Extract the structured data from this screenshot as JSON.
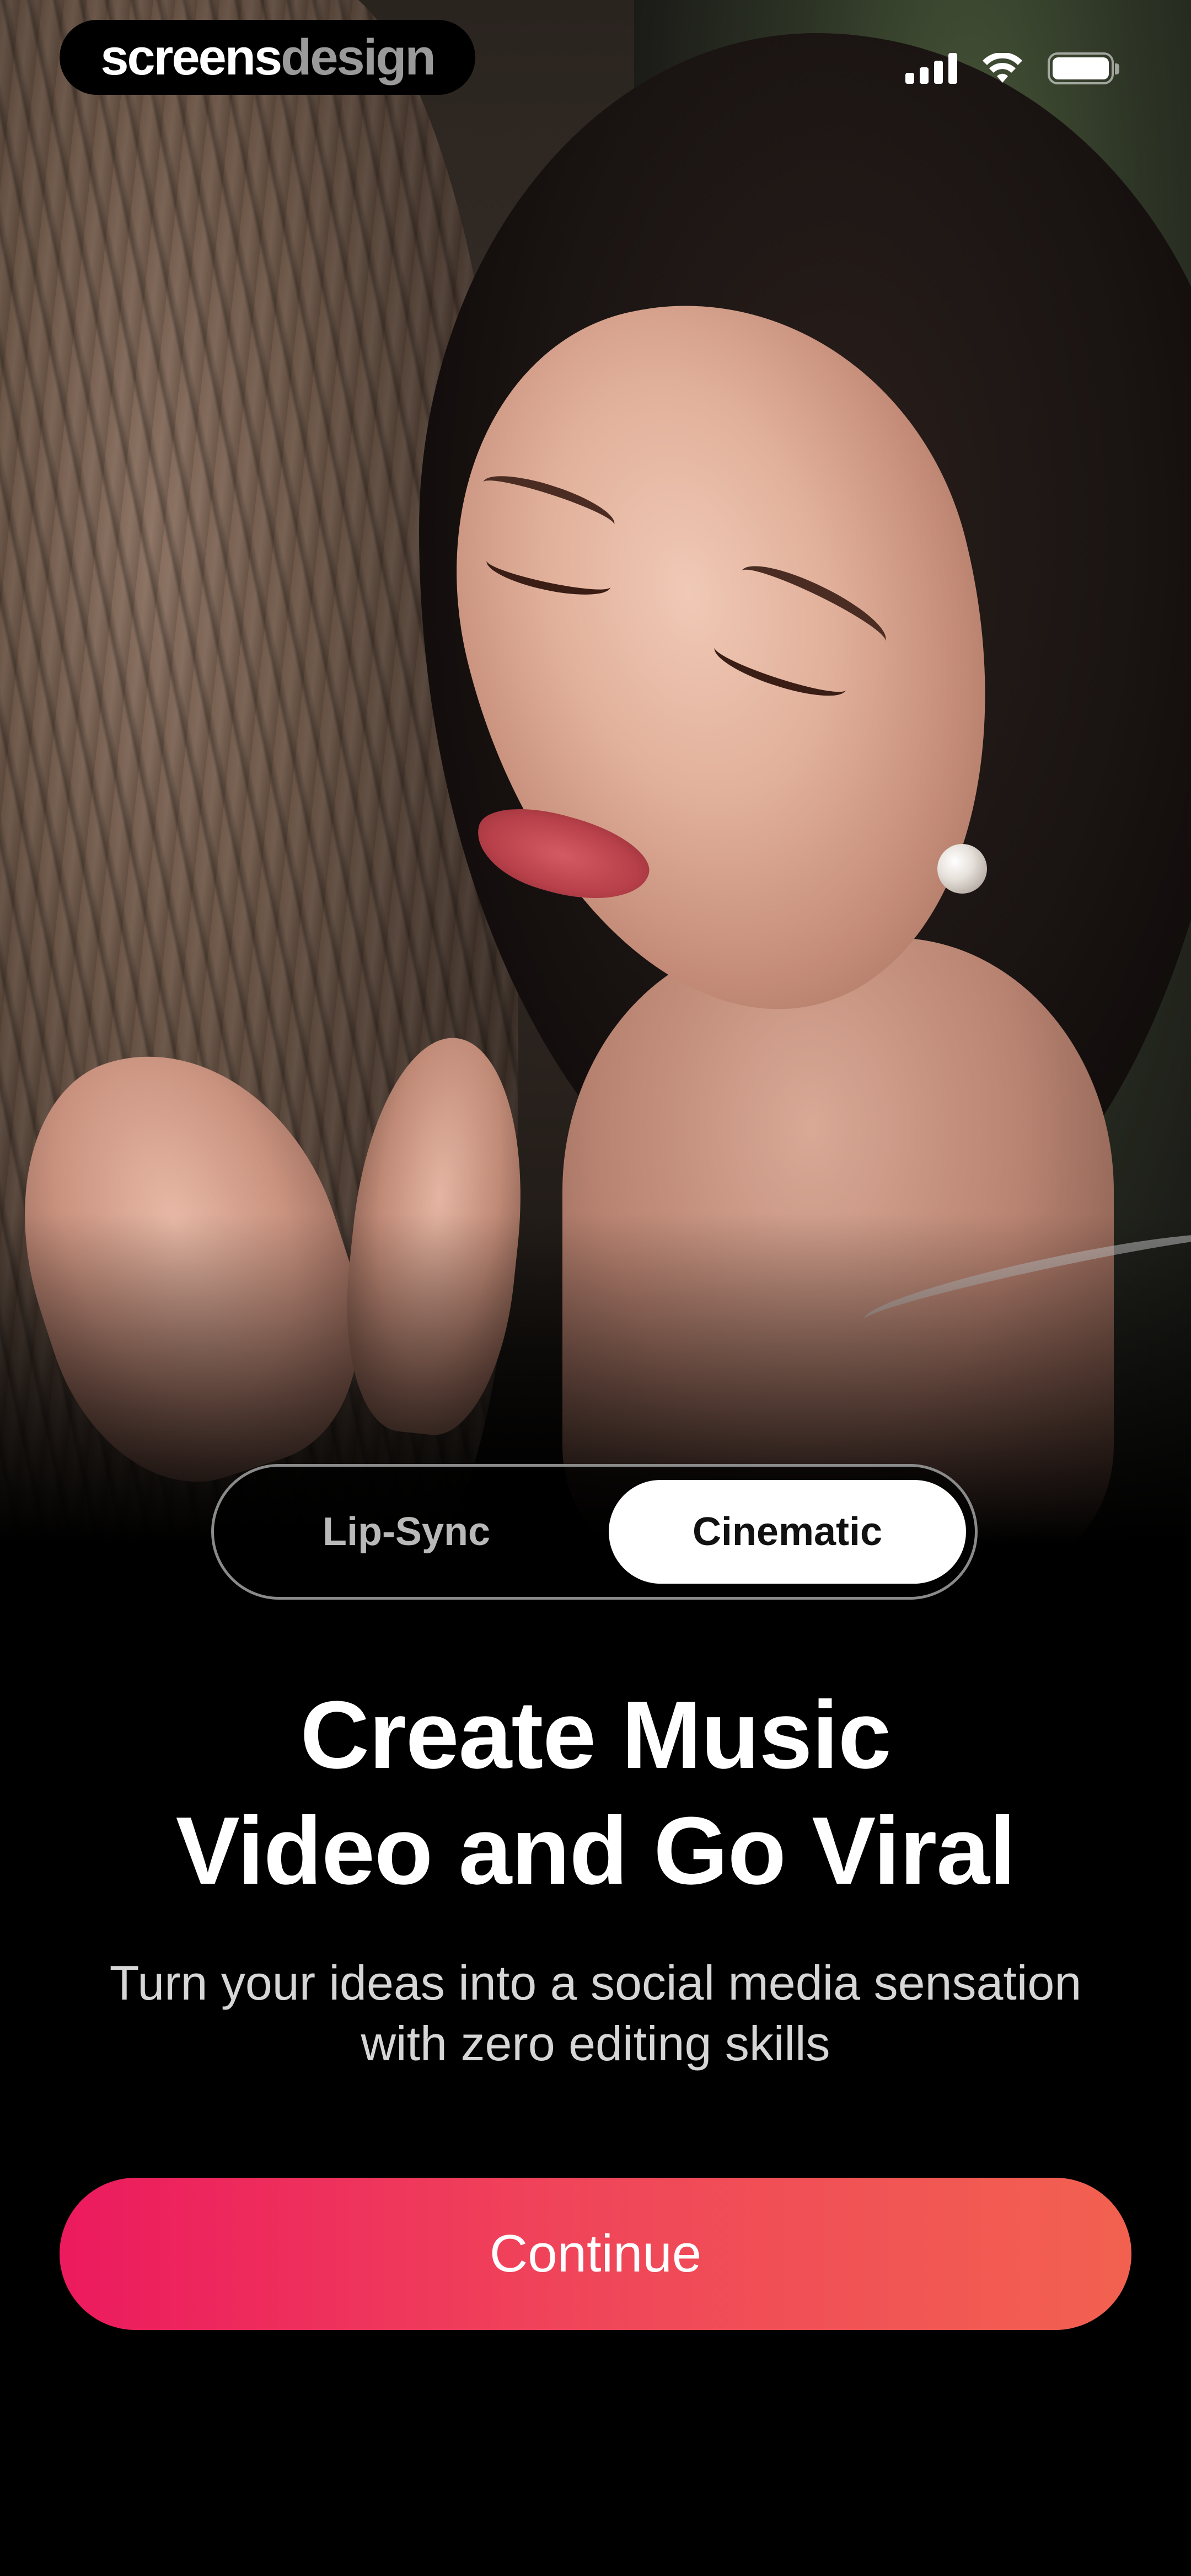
{
  "watermark": {
    "part1": "screens",
    "part2": "design"
  },
  "status_bar": {
    "signal_icon": "cellular-signal-icon",
    "wifi_icon": "wifi-icon",
    "battery_icon": "battery-icon",
    "battery_level": 1.0
  },
  "hero": {
    "image": "woman-leaning-on-tree-photo"
  },
  "mode_toggle": {
    "options": [
      "Lip-Sync",
      "Cinematic"
    ],
    "selected": "Cinematic"
  },
  "headline": {
    "line1": "Create Music",
    "line2": "Video and Go Viral"
  },
  "subtitle": {
    "line1": "Turn your ideas into a social media sensation",
    "line2": "with zero editing skills"
  },
  "continue_button": {
    "label": "Continue"
  },
  "colors": {
    "background": "#000000",
    "button_gradient_start": "#ec1a5e",
    "button_gradient_end": "#f26150",
    "selected_segment": "#ffffff"
  }
}
